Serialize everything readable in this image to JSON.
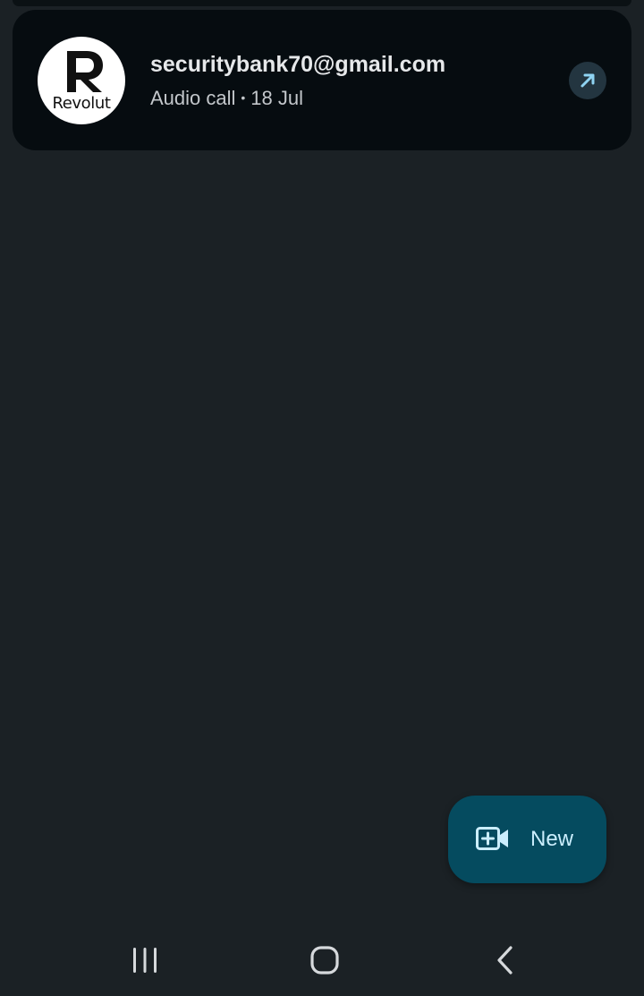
{
  "call_log": [
    {
      "contact": "securitybank70@gmail.com",
      "call_type": "Audio call",
      "separator": "•",
      "date": "18 Jul",
      "avatar": {
        "brand_text": "Revolut",
        "logo_letter": "R",
        "icon": "revolut-logo"
      },
      "direction_icon": "outgoing-call-arrow-icon"
    }
  ],
  "fab": {
    "label": "New",
    "icon": "video-call-add-icon"
  },
  "navigation_bar": {
    "items": [
      "recent-apps-icon",
      "home-icon",
      "back-icon"
    ]
  },
  "colors": {
    "background": "#1b2125",
    "card": "#060c10",
    "fab_background": "#054b5f",
    "fab_text": "#cbeefd",
    "accent_arrow": "#8fd3f2"
  }
}
